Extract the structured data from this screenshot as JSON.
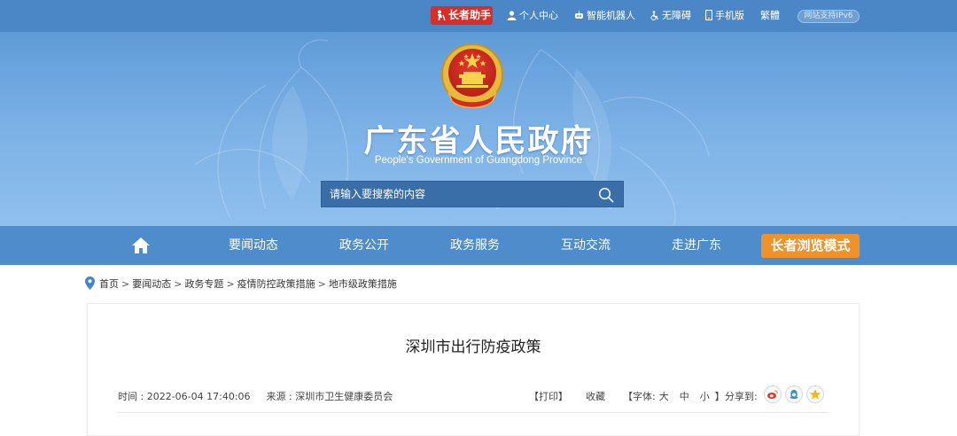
{
  "topbar": {
    "elder_assistant": "长者助手",
    "personal_center": "个人中心",
    "robot": "智能机器人",
    "accessibility": "无障碍",
    "mobile": "手机版",
    "traditional": "繁體",
    "ipv6": "网站支持IPv6"
  },
  "header": {
    "title": "广东省人民政府",
    "subtitle": "People's Government of Guangdong Province",
    "search_placeholder": "请输入要搜索的内容"
  },
  "nav": {
    "items": [
      "要闻动态",
      "政务公开",
      "政务服务",
      "互动交流",
      "走进广东"
    ],
    "elder_mode": "长者浏览模式"
  },
  "breadcrumb": [
    "首页",
    "要闻动态",
    "政务专题",
    "疫情防控政策措施",
    "地市级政策措施"
  ],
  "breadcrumb_sep": ">",
  "article": {
    "title": "深圳市出行防疫政策",
    "time": "时间 : 2022-06-04 17:40:06",
    "source": "来源 : 深圳市卫生健康委员会",
    "print": "【打印】",
    "favorite": "收藏",
    "font_label": "【字体:",
    "font_large": "大",
    "font_medium": "中",
    "font_small": "小",
    "font_close": "】",
    "share": "分享到:"
  },
  "colors": {
    "topbar": "#4b87c6",
    "nav": "#4f8ccb",
    "elder_btn": "#d62f2a",
    "elder_mode": "#f0922a"
  },
  "icons": [
    "person-icon",
    "robot-icon",
    "accessibility-icon",
    "mobile-icon",
    "search-icon",
    "home-icon",
    "location-pin-icon",
    "weibo-icon",
    "qq-icon",
    "qzone-icon"
  ]
}
